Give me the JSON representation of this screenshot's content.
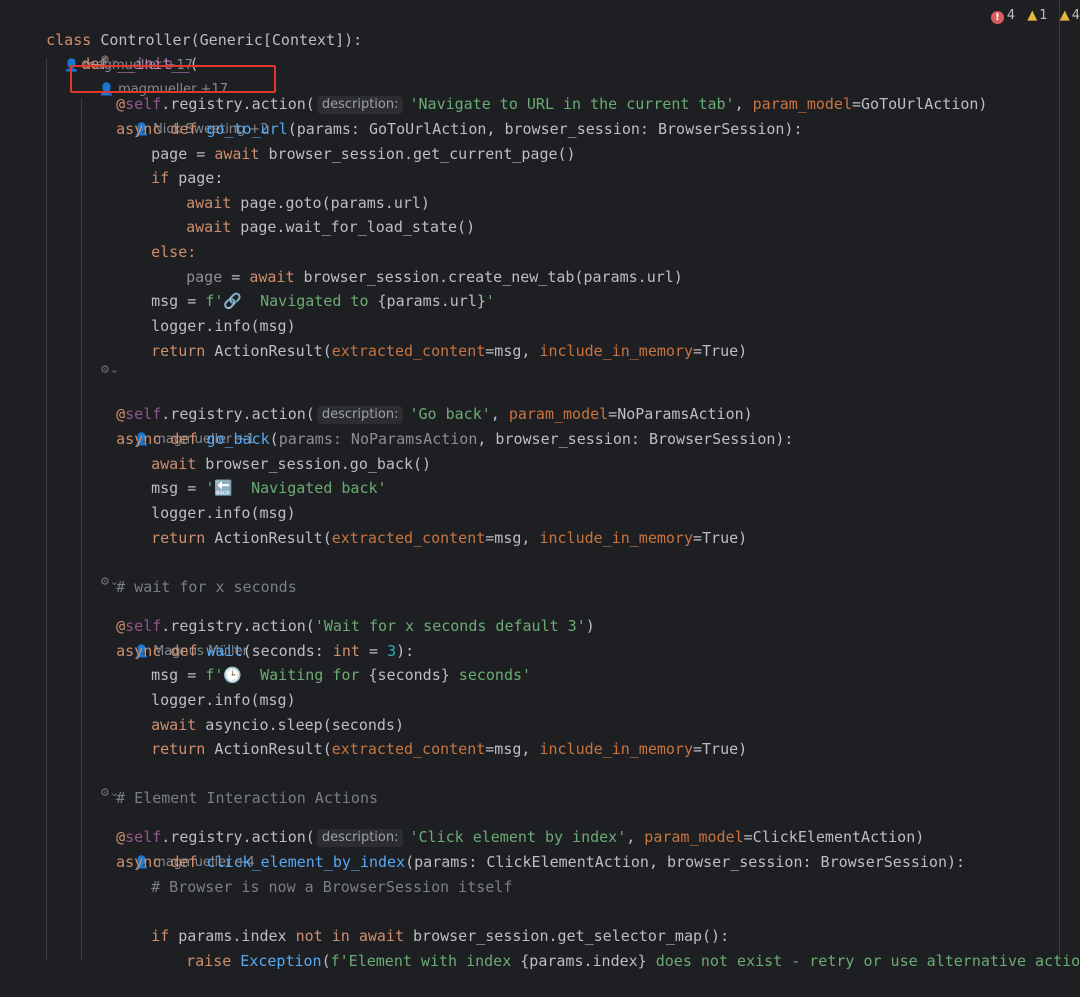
{
  "status": {
    "errors": "4",
    "warnings": "1",
    "weak_warnings": "4"
  },
  "class_line": {
    "kw": "class",
    "name": "Controller(Generic[Context]):",
    "author": "magmueller +17"
  },
  "init_line": {
    "kw": "def",
    "name": "__init__",
    "paren": "(",
    "author": "magmueller +17"
  },
  "hints": {
    "description": "description:",
    "params": "params:"
  },
  "block1": {
    "decorator_at": "@",
    "self": "self",
    "decorator_rest": ".registry.action(",
    "desc_str": "'Navigate to URL in the current tab'",
    "comma": ",",
    "param_model_kw": "param_model",
    "param_model_val": "=GoToUrlAction)",
    "author": "Nick Sweeting +2",
    "def_async": "async",
    "def_kw": "def",
    "fn": "go_to_url",
    "sig": "(params: GoToUrlAction, browser_session: BrowserSession):",
    "l1_a": "page = ",
    "l1_await": "await",
    "l1_b": " browser_session.get_current_page()",
    "l2_if": "if",
    "l2_b": " page:",
    "l3_await": "await",
    "l3_b": " page.goto(params.url)",
    "l4_await": "await",
    "l4_b": " page.wait_for_load_state()",
    "l5_else": "else:",
    "l6_a": "page",
    "l6_b": " = ",
    "l6_await": "await",
    "l6_c": " browser_session.create_new_tab(params.url)",
    "l7_a": "msg = ",
    "l7_f": "f'",
    "l7_icon": "🔗",
    "l7_str": "  Navigated to ",
    "l7_expr": "{params.url}",
    "l7_end": "'",
    "l8": "logger.info(msg)",
    "l9_return": "return",
    "l9_a": " ActionResult(",
    "l9_p1": "extracted_content",
    "l9_b": "=msg, ",
    "l9_p2": "include_in_memory",
    "l9_c": "=True)"
  },
  "block2": {
    "decorator_at": "@",
    "self": "self",
    "decorator_rest": ".registry.action(",
    "desc_str": "'Go back'",
    "comma": ", ",
    "param_model_kw": "param_model",
    "param_model_val": "=NoParamsAction)",
    "author": "magmueller +1",
    "def_async": "async",
    "def_kw": "def",
    "fn": "go_back",
    "sig_a": "(",
    "sig_dim": "params: NoParamsAction",
    "sig_b": ", browser_session: BrowserSession):",
    "l1_await": "await",
    "l1_b": " browser_session.go_back()",
    "l2_a": "msg = ",
    "l2_str": "'",
    "l2_icon": "🔙",
    "l2_str2": "  Navigated back'",
    "l3": "logger.info(msg)",
    "l4_return": "return",
    "l4_a": " ActionResult(",
    "l4_p1": "extracted_content",
    "l4_b": "=msg, ",
    "l4_p2": "include_in_memory",
    "l4_c": "=True)"
  },
  "block3": {
    "comment": "# wait for x seconds",
    "decorator_at": "@",
    "self": "self",
    "decorator_rest": ".registry.action(",
    "desc_str": "'Wait for x seconds default 3'",
    "close": ")",
    "author": "Magnus Müller",
    "def_async": "async",
    "def_kw": "def",
    "fn": "wait",
    "sig_a": "(seconds: ",
    "sig_int": "int",
    "sig_b": " = ",
    "sig_num": "3",
    "sig_c": "):",
    "l1_a": "msg = ",
    "l1_f": "f'",
    "l1_icon": "🕒",
    "l1_str": "  Waiting for ",
    "l1_expr": "{seconds}",
    "l1_str2": " seconds'",
    "l2": "logger.info(msg)",
    "l3_await": "await",
    "l3_b": " asyncio.sleep(seconds)",
    "l4_return": "return",
    "l4_a": " ActionResult(",
    "l4_p1": "extracted_content",
    "l4_b": "=msg, ",
    "l4_p2": "include_in_memory",
    "l4_c": "=True)"
  },
  "block4": {
    "comment": "# Element Interaction Actions",
    "decorator_at": "@",
    "self": "self",
    "decorator_rest": ".registry.action(",
    "desc_str": "'Click element by index'",
    "comma": ", ",
    "param_model_kw": "param_model",
    "param_model_val": "=ClickElementAction)",
    "author": "magmueller +4",
    "def_async": "async",
    "def_kw": "def",
    "fn": "click_element_by_index",
    "sig": "(params: ClickElementAction, browser_session: BrowserSession):",
    "l1_comment": "# Browser is now a BrowserSession itself",
    "l2_if": "if",
    "l2_a": " params.index ",
    "l2_not": "not",
    "l2_sp": " ",
    "l2_in": "in",
    "l2_sp2": " ",
    "l2_await": "await",
    "l2_b": " browser_session.get_selector_map():",
    "l3_raise": "raise",
    "l3_exc": " Exception",
    "l3_a": "(",
    "l3_f": "f'Element with index ",
    "l3_expr": "{params.index}",
    "l3_str2": " does not exist - retry or use alternative actions'",
    "l3_close": ")"
  },
  "fold_glyph": "⚙⌄"
}
